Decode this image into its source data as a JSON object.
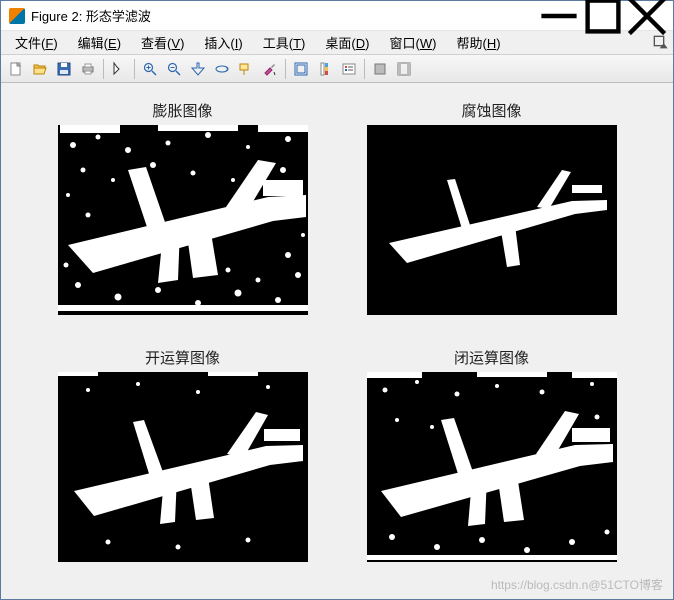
{
  "window": {
    "title": "Figure 2: 形态学滤波"
  },
  "menu": {
    "file": {
      "label": "文件",
      "accel": "F"
    },
    "edit": {
      "label": "编辑",
      "accel": "E"
    },
    "view": {
      "label": "查看",
      "accel": "V"
    },
    "insert": {
      "label": "插入",
      "accel": "I"
    },
    "tools": {
      "label": "工具",
      "accel": "T"
    },
    "desktop": {
      "label": "桌面",
      "accel": "D"
    },
    "window": {
      "label": "窗口",
      "accel": "W"
    },
    "help": {
      "label": "帮助",
      "accel": "H"
    }
  },
  "subplots": {
    "tl": {
      "title": "膨胀图像"
    },
    "tr": {
      "title": "腐蚀图像"
    },
    "bl": {
      "title": "开运算图像"
    },
    "br": {
      "title": "闭运算图像"
    }
  },
  "watermark": "https://blog.csdn.n@51CTO博客"
}
